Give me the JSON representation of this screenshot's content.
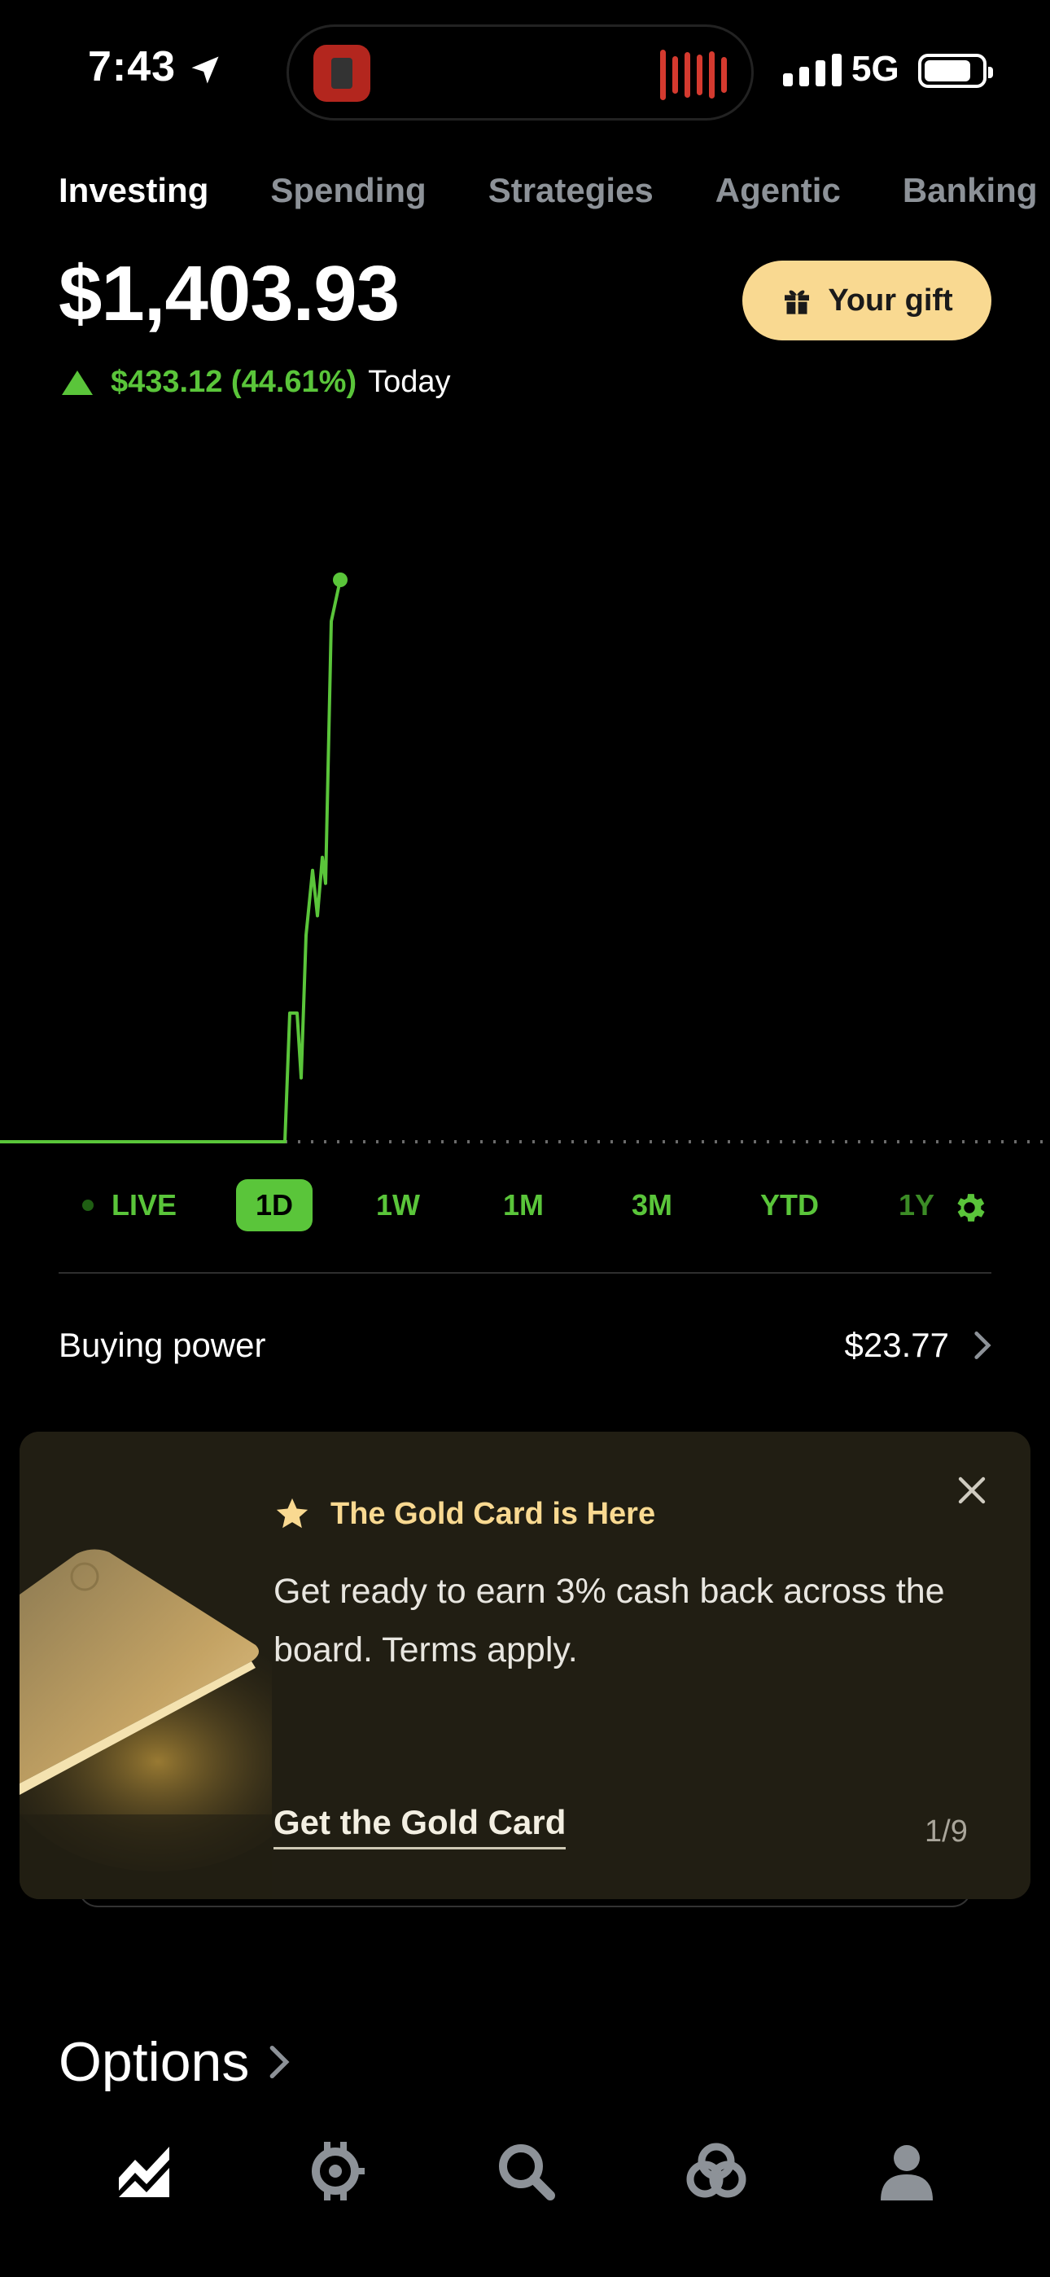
{
  "status_bar": {
    "time": "7:43",
    "network": "5G",
    "icons": [
      "location-arrow-icon",
      "cellular-signal-icon",
      "battery-icon"
    ]
  },
  "tabs": [
    {
      "label": "Investing",
      "active": true
    },
    {
      "label": "Spending",
      "active": false
    },
    {
      "label": "Strategies",
      "active": false
    },
    {
      "label": "Agentic",
      "active": false
    },
    {
      "label": "Banking",
      "active": false
    }
  ],
  "portfolio": {
    "balance": "$1,403.93",
    "change": "$433.12 (44.61%)",
    "change_period": "Today",
    "change_direction": "up"
  },
  "gift_button": {
    "label": "Your gift",
    "icon": "gift-icon"
  },
  "chart_data": {
    "type": "line",
    "title": "",
    "xlabel": "",
    "ylabel": "",
    "x": [
      0,
      1,
      2,
      3,
      4,
      5,
      6,
      7,
      8,
      9,
      10,
      11,
      12
    ],
    "series": [
      {
        "values": [
          970.81,
          970.81,
          970.81,
          1070,
          1070,
          1020,
          1130,
          1180,
          1145,
          1190,
          1170,
          1372,
          1403.93
        ]
      }
    ],
    "reference_line": 970.81,
    "line_color": "#5ac53a"
  },
  "ranges": {
    "items": [
      {
        "label": "LIVE",
        "selected": false
      },
      {
        "label": "1D",
        "selected": true
      },
      {
        "label": "1W",
        "selected": false
      },
      {
        "label": "1M",
        "selected": false
      },
      {
        "label": "3M",
        "selected": false
      },
      {
        "label": "YTD",
        "selected": false
      },
      {
        "label": "1Y",
        "selected": false
      }
    ],
    "settings_icon": "gear-icon"
  },
  "buying_power": {
    "label": "Buying power",
    "value": "$23.77"
  },
  "promo": {
    "title": "The Gold Card is Here",
    "body": "Get ready to earn 3% cash back across the board. Terms apply.",
    "cta": "Get the Gold Card",
    "page": "1/9"
  },
  "options": {
    "label": "Options"
  },
  "bottom_nav": [
    {
      "name": "investing",
      "icon": "chart-icon",
      "active": true
    },
    {
      "name": "crypto",
      "icon": "crypto-icon",
      "active": false
    },
    {
      "name": "search",
      "icon": "search-icon",
      "active": false
    },
    {
      "name": "strategies",
      "icon": "strategies-icon",
      "active": false
    },
    {
      "name": "account",
      "icon": "person-icon",
      "active": false
    }
  ],
  "colors": {
    "accent_green": "#5ac53a",
    "gift_gold": "#f9d991",
    "promo_bg": "#211e13",
    "background": "#000000"
  }
}
